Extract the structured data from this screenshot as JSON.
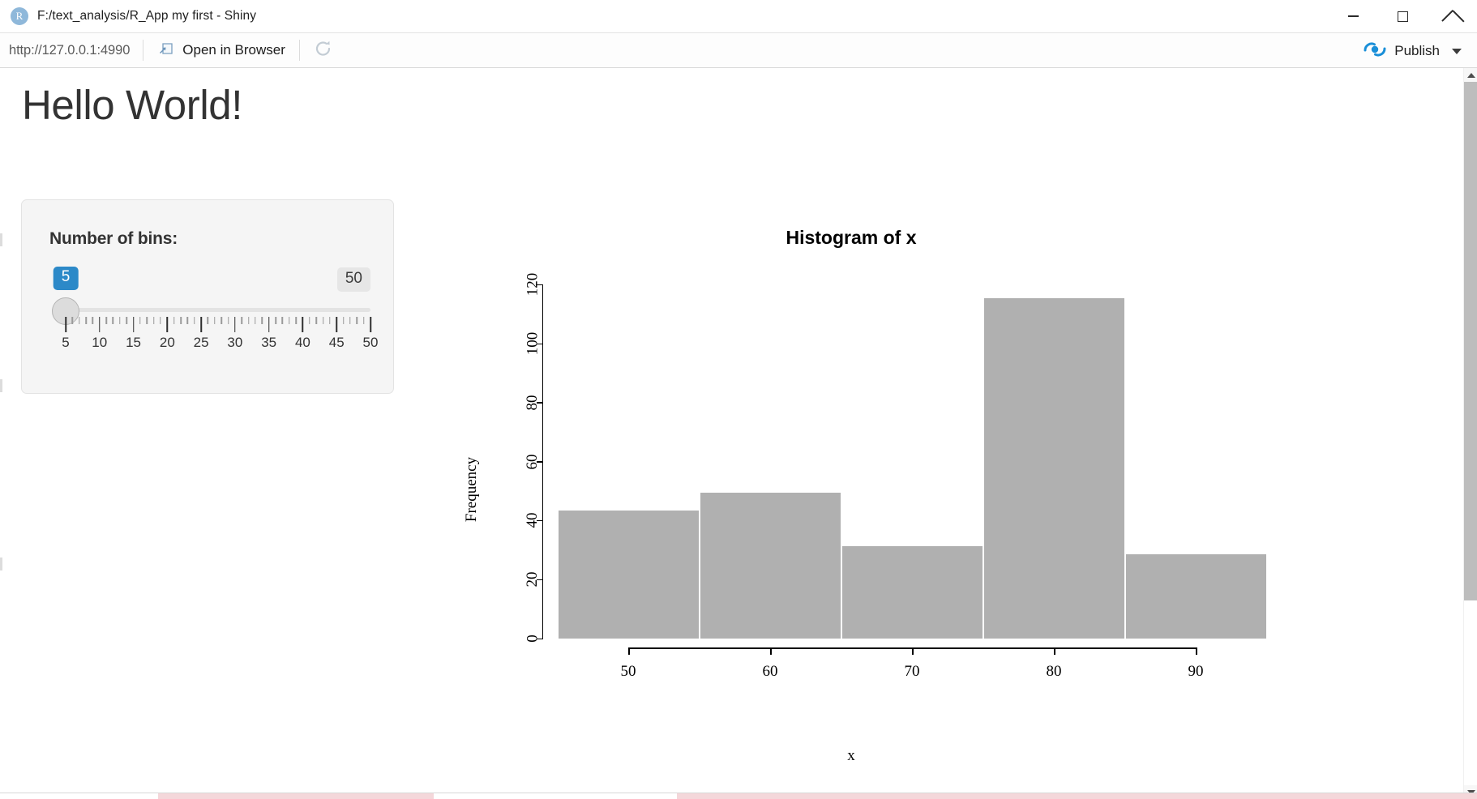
{
  "window": {
    "title": "F:/text_analysis/R_App my first - Shiny",
    "app_icon": "r-logo-icon",
    "controls": {
      "minimize": "minimize-button",
      "maximize": "maximize-button",
      "close": "close-button"
    }
  },
  "toolbar": {
    "url": "http://127.0.0.1:4990",
    "open_in_browser_label": "Open in Browser",
    "open_in_browser_icon": "external-link-icon",
    "refresh_icon": "refresh-icon",
    "publish_label": "Publish",
    "publish_icon": "publish-icon",
    "publish_dropdown_icon": "chevron-down-icon"
  },
  "app": {
    "heading": "Hello World!",
    "slider": {
      "label": "Number of bins:",
      "value": "5",
      "max_label": "50",
      "min": 5,
      "max": 50,
      "current": 5,
      "tick_labels": [
        "5",
        "10",
        "15",
        "20",
        "25",
        "30",
        "35",
        "40",
        "45",
        "50"
      ],
      "tick_values": [
        5,
        10,
        15,
        20,
        25,
        30,
        35,
        40,
        45,
        50
      ],
      "minor_ticks_per_interval": 4,
      "accent_color": "#2c89c8"
    }
  },
  "chart_data": {
    "type": "bar",
    "title": "Histogram of x",
    "xlabel": "x",
    "ylabel": "Frequency",
    "bin_edges": [
      45,
      55,
      65,
      75,
      85,
      95
    ],
    "categories": [
      "45-55",
      "55-65",
      "65-75",
      "75-85",
      "85-95"
    ],
    "values": [
      44,
      50,
      32,
      116,
      29
    ],
    "bar_color": "#b0b0b0",
    "bar_border_color": "#ffffff",
    "grid": false,
    "legend": "none",
    "xlim": [
      44,
      96
    ],
    "ylim": [
      0,
      125
    ],
    "xticks": [
      50,
      60,
      70,
      80,
      90
    ],
    "xtick_labels": [
      "50",
      "60",
      "70",
      "80",
      "90"
    ],
    "yticks": [
      0,
      20,
      40,
      60,
      80,
      100,
      120
    ],
    "ytick_labels": [
      "0",
      "20",
      "40",
      "60",
      "80",
      "100",
      "120"
    ]
  },
  "scrollbar": {
    "up_icon": "scroll-up-arrow-icon",
    "down_icon": "scroll-down-arrow-icon"
  }
}
